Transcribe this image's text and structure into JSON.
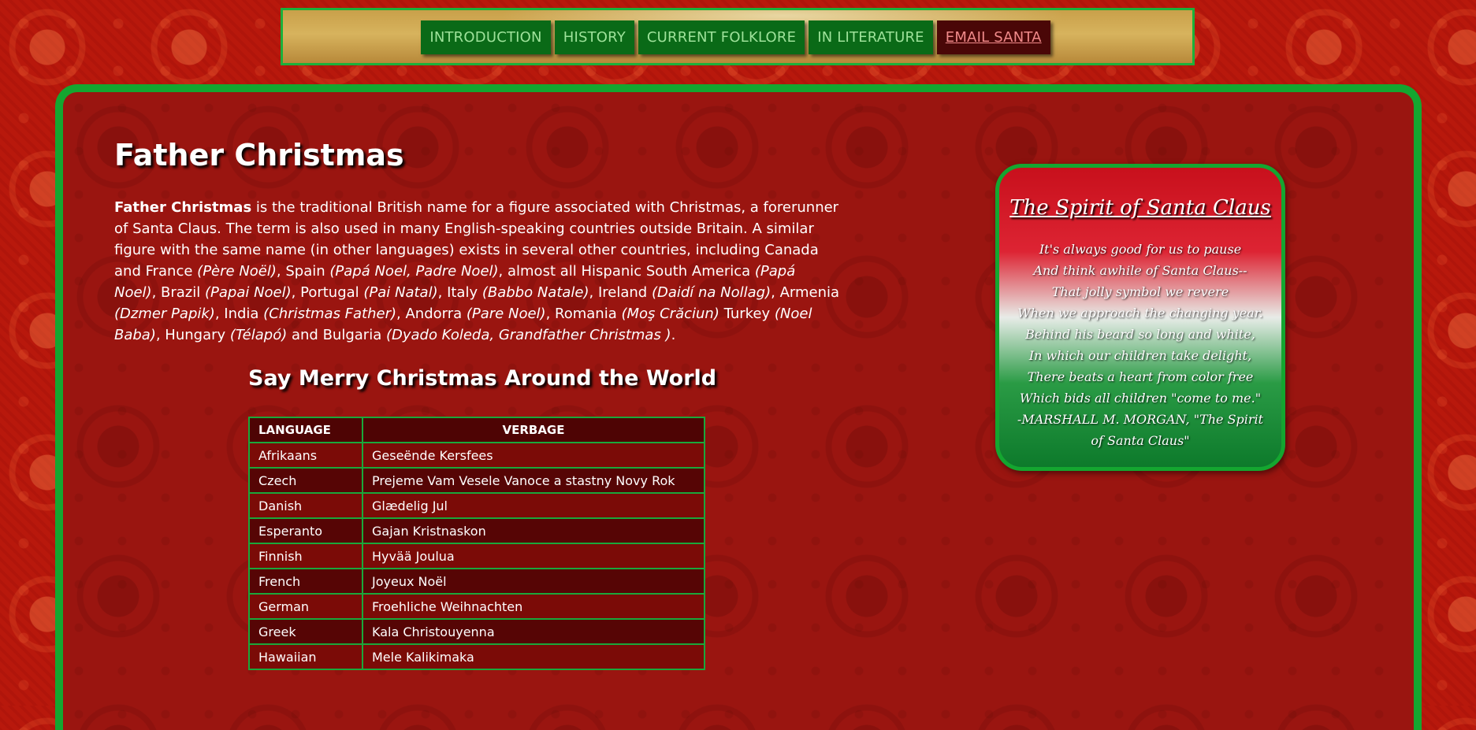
{
  "nav": {
    "items": [
      {
        "label": "INTRODUCTION"
      },
      {
        "label": "HISTORY"
      },
      {
        "label": "CURRENT FOLKLORE"
      },
      {
        "label": "IN LITERATURE"
      },
      {
        "label": "EMAIL SANTA"
      }
    ]
  },
  "page": {
    "title": "Father Christmas",
    "intro": {
      "lead_bold": "Father Christmas",
      "s1": " is the traditional British name for a figure associated with Christmas, a forerunner of Santa Claus. The term is also used in many English-speaking countries outside Britain. A similar figure with the same name (in other languages) exists in several other countries, including Canada and France ",
      "france": "(Père Noël)",
      "s2": ", Spain ",
      "spain": "(Papá Noel, Padre Noel)",
      "s3": ", almost all Hispanic South America ",
      "south_america": "(Papá Noel)",
      "s4": ", Brazil ",
      "brazil": "(Papai Noel)",
      "s5": ", Portugal ",
      "portugal": "(Pai Natal)",
      "s6": ", Italy ",
      "italy": "(Babbo Natale)",
      "s7": ", Ireland ",
      "ireland": "(Daidí na Nollag)",
      "s8": ", Armenia ",
      "armenia": "(Dzmer Papik)",
      "s9": ", India ",
      "india": "(Christmas Father)",
      "s10": ", Andorra ",
      "andorra": "(Pare Noel)",
      "s11": ", Romania ",
      "romania": "(Moş Crăciun)",
      "s12": " Turkey ",
      "turkey": "(Noel Baba)",
      "s13": ", Hungary ",
      "hungary": "(Télapó)",
      "s14": " and Bulgaria ",
      "bulgaria": "(Dyado Koleda, Grandfather Christmas )",
      "s15": "."
    }
  },
  "table": {
    "heading": "Say Merry Christmas Around the World",
    "headers": {
      "language": "LANGUAGE",
      "verbage": "VERBAGE"
    },
    "rows": [
      {
        "language": "Afrikaans",
        "verbage": "Geseënde Kersfees"
      },
      {
        "language": "Czech",
        "verbage": "Prejeme Vam Vesele Vanoce a stastny Novy Rok"
      },
      {
        "language": "Danish",
        "verbage": "Glædelig Jul"
      },
      {
        "language": "Esperanto",
        "verbage": "Gajan Kristnaskon"
      },
      {
        "language": "Finnish",
        "verbage": "Hyvää Joulua"
      },
      {
        "language": "French",
        "verbage": "Joyeux Noël"
      },
      {
        "language": "German",
        "verbage": "Froehliche Weihnachten"
      },
      {
        "language": "Greek",
        "verbage": "Kala Christouyenna"
      },
      {
        "language": "Hawaiian",
        "verbage": "Mele Kalikimaka"
      }
    ]
  },
  "poem": {
    "title": "The Spirit of Santa Claus",
    "lines": [
      "It's always good for us to pause",
      "And think awhile of Santa Claus--",
      "That jolly symbol we revere",
      "When we approach the changing year.",
      "Behind his beard so long and white,",
      "In which our children take delight,",
      "There beats a heart from color free",
      "Which bids all children \"come to me.\"",
      "-MARSHALL M. MORGAN, \"The Spirit",
      "of Santa Claus\""
    ]
  },
  "colors": {
    "background": "#b8180c",
    "panel_border": "#14a630",
    "nav_button": "#0a6a17",
    "nav_button_active": "#4a0707"
  }
}
